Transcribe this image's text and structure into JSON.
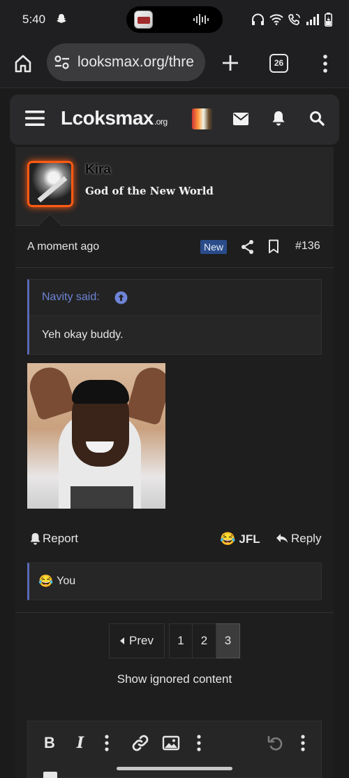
{
  "status_bar": {
    "time": "5:40",
    "icons": [
      "snapchat-icon",
      "recording-wave-icon",
      "headphones-icon",
      "wifi-icon",
      "wifi-call-icon",
      "signal-icon",
      "battery-charging-icon"
    ]
  },
  "browser": {
    "url": "looksmax.org/thre",
    "tab_count": "26"
  },
  "site_header": {
    "logo_main": "Lcoksmax",
    "logo_suffix": ".org"
  },
  "post": {
    "author": "Kira",
    "user_title": "God of the New World",
    "time": "A moment ago",
    "new_badge": "New",
    "number": "#136",
    "quote": {
      "author_label": "Navity said:",
      "text": "Yeh okay buddy."
    },
    "actions": {
      "report": "Report",
      "reaction": "JFL",
      "reply": "Reply"
    },
    "reactions_summary": {
      "emoji": "😂",
      "text": "You"
    }
  },
  "pagination": {
    "prev": "Prev",
    "pages": [
      "1",
      "2",
      "3"
    ],
    "current": "3"
  },
  "ignored_link": "Show ignored content",
  "colors": {
    "accent_blue": "#5a6ab8",
    "quote_author": "#6e84d6",
    "new_badge": "#2a4c8a",
    "avatar_glow": "#ff5a12"
  }
}
